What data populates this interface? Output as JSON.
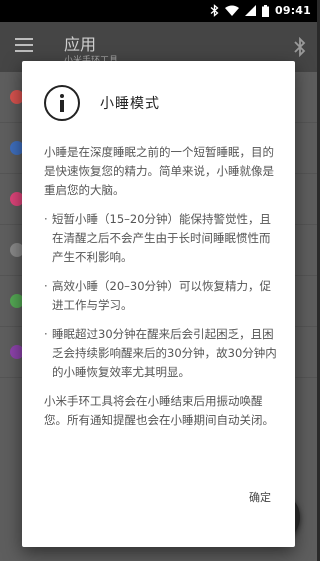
{
  "status_bar": {
    "time": "09:41",
    "icons": [
      "bluetooth-icon",
      "wifi-icon",
      "signal-icon",
      "battery-icon"
    ]
  },
  "app_bar": {
    "title": "应用",
    "subtitle": "小米手环工具",
    "menu_icon": "menu-icon",
    "action_icon": "bluetooth-icon"
  },
  "background_list": {
    "dot_colors": [
      "#d9534f",
      "#3f6fbf",
      "#e0457b",
      "#8a8a8a",
      "#55aa55",
      "#8e44ad"
    ]
  },
  "dialog": {
    "icon": "info-icon",
    "title": "小睡模式",
    "intro": "小睡是在深度睡眠之前的一个短暂睡眠，目的是快速恢复您的精力。简单来说，小睡就像是重启您的大脑。",
    "bullets": [
      "短暂小睡（15–20分钟）能保持警觉性，且在清醒之后不会产生由于长时间睡眠惯性而产生不利影响。",
      "高效小睡（20–30分钟）可以恢复精力，促进工作与学习。",
      "睡眠超过30分钟在醒来后会引起困乏，且困乏会持续影响醒来后的30分钟，故30分钟内的小睡恢复效率尤其明显。"
    ],
    "footer_text": "小米手环工具将会在小睡结束后用振动唤醒您。所有通知提醒也会在小睡期间自动关闭。",
    "ok_label": "确定"
  },
  "colors": {
    "status_bar": "#000000",
    "app_bar": "#454545",
    "dialog_bg": "#ffffff",
    "body_text": "#555555"
  }
}
